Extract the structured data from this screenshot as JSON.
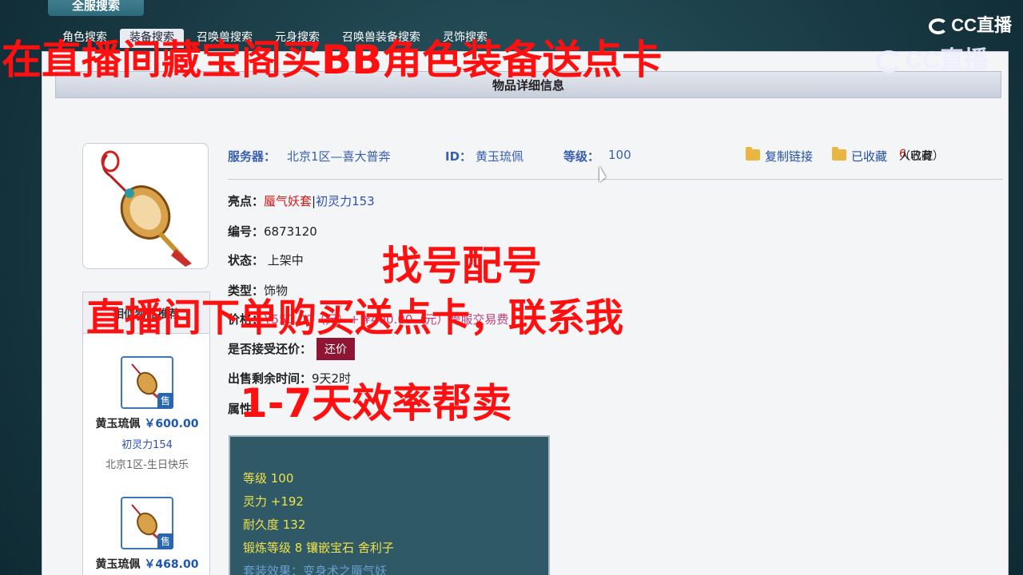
{
  "header": {
    "title": "全服搜索",
    "tabs": [
      {
        "label": "角色搜索",
        "active": false
      },
      {
        "label": "装备搜索",
        "active": true
      },
      {
        "label": "召唤兽搜索",
        "active": false
      },
      {
        "label": "元身搜索",
        "active": false
      },
      {
        "label": "召唤兽装备搜索",
        "active": false
      },
      {
        "label": "灵饰搜索",
        "active": false
      }
    ],
    "logo_small": "CC直播",
    "logo_big": "CC直播"
  },
  "panel": {
    "title": "物品详细信息",
    "item_image_icon": "jade-pendant-icon"
  },
  "info": {
    "server_label": "服务器：",
    "server": "北京1区—喜大普奔",
    "id_label": "ID：",
    "id": "黄玉琉佩",
    "level_label": "等级：",
    "level": "100",
    "copy_link": "复制链接",
    "favorited": "已收藏",
    "fav_prefix": "（已有",
    "fav_count": "6",
    "fav_suffix": "人收藏）"
  },
  "details": {
    "highlight_label": "亮点：",
    "highlight_red": "蜃气妖套",
    "highlight_sep": "|",
    "highlight_blue": "初灵力153",
    "number_label": "编号：",
    "number": "6873120",
    "status_label": "状态：",
    "status": "上架中",
    "type_label": "类型：",
    "type": "饰物",
    "price_label": "价格：",
    "price": "¥550.00（元）+ ¥400.00（元）跨服交易费",
    "bargain_label": "是否接受还价：",
    "bargain_button": "还价",
    "remaining_label": "出售剩余时间：",
    "remaining": "9天2时",
    "attr_label": "属性："
  },
  "attributes": [
    {
      "text": "等级 100",
      "dim": false
    },
    {
      "text": "灵力 +192",
      "dim": false
    },
    {
      "text": "耐久度 132",
      "dim": false
    },
    {
      "text": "锻炼等级 8  镶嵌宝石 舍利子",
      "dim": false
    },
    {
      "text": "套装效果：变身术之蜃气妖",
      "dim": true
    }
  ],
  "sidebar": {
    "heading": "相似物品推荐",
    "items": [
      {
        "name": "黄玉琉佩",
        "price": "￥600.00",
        "attr": "初灵力154",
        "server": "北京1区-生日快乐",
        "badge": "售"
      },
      {
        "name": "黄玉琉佩",
        "price": "￥468.00",
        "attr": "",
        "server": "",
        "badge": "售"
      }
    ]
  },
  "overlays": {
    "line1": "在直播间藏宝阁买BB角色装备送点卡",
    "line2": "找号配号",
    "line3": "直播间下单购买送点卡，联系我",
    "line4": "1-7天效率帮卖"
  }
}
